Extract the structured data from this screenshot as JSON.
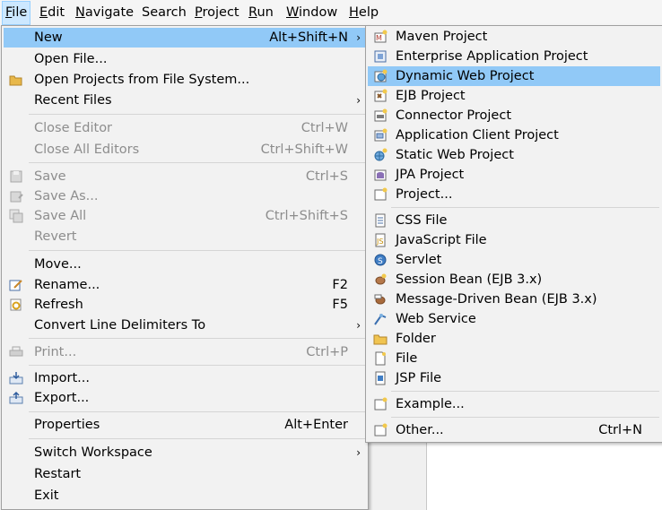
{
  "menubar": {
    "items": [
      {
        "label": "File",
        "ul": "F",
        "rest": "ile"
      },
      {
        "label": "Edit",
        "ul": "E",
        "rest": "dit"
      },
      {
        "label": "Navigate",
        "ul": "N",
        "rest": "avigate"
      },
      {
        "label": "Search",
        "ul": "",
        "rest": "Search"
      },
      {
        "label": "Project",
        "ul": "P",
        "rest": "roject"
      },
      {
        "label": "Run",
        "ul": "R",
        "rest": "un"
      },
      {
        "label": "Window",
        "ul": "W",
        "rest": "indow"
      },
      {
        "label": "Help",
        "ul": "H",
        "rest": "elp"
      }
    ]
  },
  "file_menu": {
    "new": {
      "label": "New",
      "accel": "Alt+Shift+N"
    },
    "open_file": {
      "label": "Open File..."
    },
    "open_projects": {
      "label": "Open Projects from File System..."
    },
    "recent_files": {
      "label": "Recent Files"
    },
    "close_editor": {
      "label": "Close Editor",
      "accel": "Ctrl+W"
    },
    "close_all_editors": {
      "label": "Close All Editors",
      "accel": "Ctrl+Shift+W"
    },
    "save": {
      "label": "Save",
      "accel": "Ctrl+S"
    },
    "save_as": {
      "label": "Save As..."
    },
    "save_all": {
      "label": "Save All",
      "accel": "Ctrl+Shift+S"
    },
    "revert": {
      "label": "Revert"
    },
    "move": {
      "label": "Move..."
    },
    "rename": {
      "label": "Rename...",
      "accel": "F2"
    },
    "refresh": {
      "label": "Refresh",
      "accel": "F5"
    },
    "convert": {
      "label": "Convert Line Delimiters To"
    },
    "print": {
      "label": "Print...",
      "accel": "Ctrl+P"
    },
    "import": {
      "label": "Import..."
    },
    "export": {
      "label": "Export..."
    },
    "properties": {
      "label": "Properties",
      "accel": "Alt+Enter"
    },
    "switch_workspace": {
      "label": "Switch Workspace"
    },
    "restart": {
      "label": "Restart"
    },
    "exit": {
      "label": "Exit"
    }
  },
  "new_menu": {
    "maven_project": {
      "label": "Maven Project"
    },
    "enterprise_app": {
      "label": "Enterprise Application Project"
    },
    "dynamic_web": {
      "label": "Dynamic Web Project"
    },
    "ejb_project": {
      "label": "EJB Project"
    },
    "connector_project": {
      "label": "Connector Project"
    },
    "app_client": {
      "label": "Application Client Project"
    },
    "static_web": {
      "label": "Static Web Project"
    },
    "jpa_project": {
      "label": "JPA Project"
    },
    "project": {
      "label": "Project..."
    },
    "css_file": {
      "label": "CSS File"
    },
    "js_file": {
      "label": "JavaScript File"
    },
    "servlet": {
      "label": "Servlet"
    },
    "session_bean": {
      "label": "Session Bean (EJB 3.x)"
    },
    "mdb": {
      "label": "Message-Driven Bean (EJB 3.x)"
    },
    "web_service": {
      "label": "Web Service"
    },
    "folder": {
      "label": "Folder"
    },
    "file": {
      "label": "File"
    },
    "jsp_file": {
      "label": "JSP File"
    },
    "example": {
      "label": "Example..."
    },
    "other": {
      "label": "Other...",
      "accel": "Ctrl+N"
    }
  },
  "colors": {
    "highlight": "#91c9f7",
    "menu_bg": "#f2f2f2",
    "disabled_text": "#8d8d8d"
  }
}
